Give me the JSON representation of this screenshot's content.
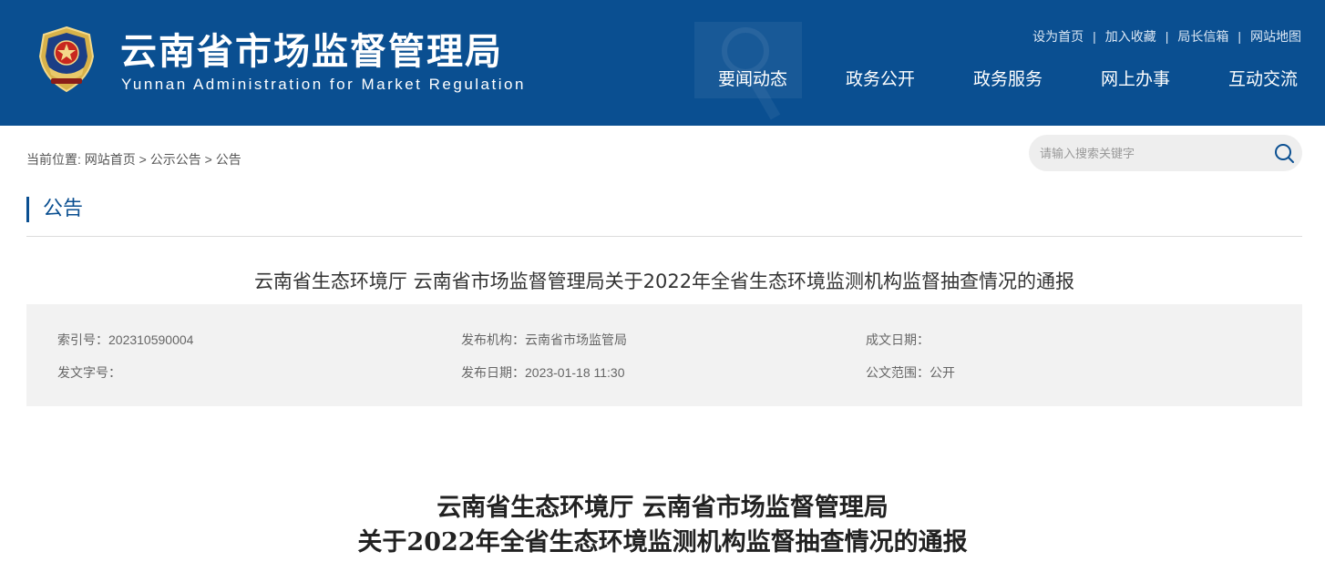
{
  "header": {
    "title": "云南省市场监督管理局",
    "subtitle": "Yunnan Administration for Market Regulation",
    "bg_color": "#0a4f91",
    "top_links": [
      "设为首页",
      "加入收藏",
      "局长信箱",
      "网站地图"
    ],
    "top_link_separator": "|",
    "nav": [
      "要闻动态",
      "政务公开",
      "政务服务",
      "网上办事",
      "互动交流"
    ]
  },
  "breadcrumb": {
    "prefix": "当前位置:",
    "items": [
      "网站首页",
      "公示公告",
      "公告"
    ],
    "separator": ">"
  },
  "search": {
    "placeholder": "请输入搜索关键字",
    "icon": "search-icon"
  },
  "section": {
    "title": "公告"
  },
  "article": {
    "heading": "云南省生态环境厅 云南省市场监督管理局关于2022年全省生态环境监测机构监督抽查情况的通报",
    "meta": {
      "index_no": "索引号：202310590004",
      "publisher": "发布机构：云南省市场监管局",
      "written_date": "成文日期：",
      "doc_number": "发文字号：",
      "publish_date": "发布日期：2023-01-18 11:30",
      "scope": "公文范围：公开"
    },
    "doc_title_line1": "云南省生态环境厅 云南省市场监督管理局",
    "doc_title_line2": "关于2022年全省生态环境监测机构监督抽查情况的通报"
  }
}
